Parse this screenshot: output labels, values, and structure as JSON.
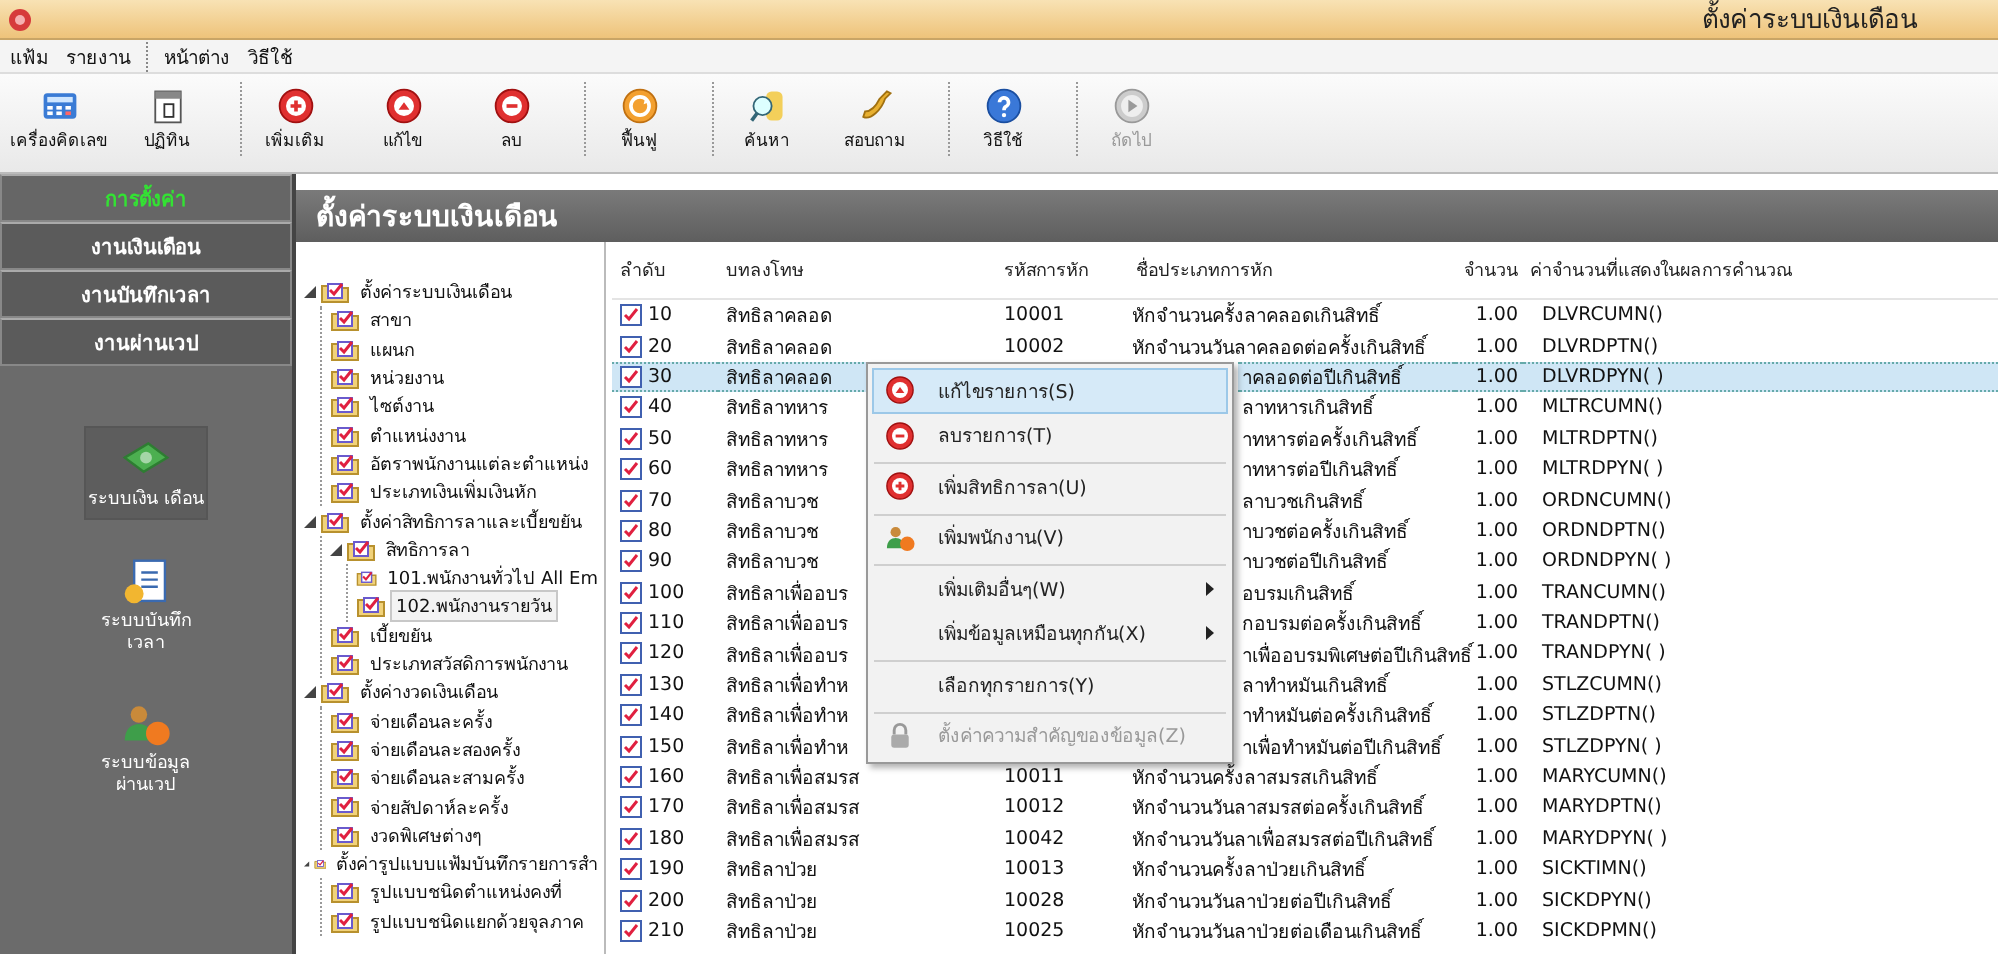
{
  "window": {
    "title": "ตั้งค่าระบบเงินเดือน"
  },
  "menu_bar": [
    {
      "label": "แฟ้ม",
      "separator_before": false
    },
    {
      "label": "รายงาน",
      "separator_before": false
    },
    {
      "label": "หน้าต่าง",
      "separator_before": true
    },
    {
      "label": "วิธีใช้",
      "separator_before": false
    }
  ],
  "toolbar": [
    {
      "label": "เครื่องคิดเลข",
      "kind": "calculator",
      "disabled": false,
      "separator_before": false
    },
    {
      "label": "ปฏิทิน",
      "kind": "calendar",
      "disabled": false,
      "separator_before": false
    },
    {
      "label": "เพิ่มเติม",
      "kind": "add",
      "disabled": false,
      "separator_before": true
    },
    {
      "label": "แก้ไข",
      "kind": "edit",
      "disabled": false,
      "separator_before": false
    },
    {
      "label": "ลบ",
      "kind": "delete",
      "disabled": false,
      "separator_before": false
    },
    {
      "label": "ฟื้นฟู",
      "kind": "refresh",
      "disabled": false,
      "separator_before": true
    },
    {
      "label": "ค้นหา",
      "kind": "search",
      "disabled": false,
      "separator_before": true
    },
    {
      "label": "สอบถาม",
      "kind": "phone",
      "disabled": false,
      "separator_before": false
    },
    {
      "label": "วิธีใช้",
      "kind": "help",
      "disabled": false,
      "separator_before": true
    },
    {
      "label": "ถัดไป",
      "kind": "next",
      "disabled": true,
      "separator_before": true
    }
  ],
  "sidebar": {
    "tabs": [
      {
        "label": "การตั้งค่า",
        "selected": true
      },
      {
        "label": "งานเงินเดือน",
        "selected": false
      },
      {
        "label": "งานบันทึกเวลา",
        "selected": false
      },
      {
        "label": "งานผ่านเวป",
        "selected": false
      }
    ],
    "systems": [
      {
        "label": "ระบบเงิน เดือน",
        "kind": "money",
        "selected": true
      },
      {
        "label": "ระบบบันทึก เวลา",
        "kind": "document",
        "selected": false
      },
      {
        "label": "ระบบข้อมูล ผ่านเวป",
        "kind": "people",
        "selected": false
      }
    ]
  },
  "panel_title": "ตั้งค่าระบบเงินเดือน",
  "tree": [
    {
      "label": "ตั้งค่าระบบเงินเดือน",
      "selected": false,
      "expanded": true,
      "children": [
        {
          "label": "สาขา",
          "selected": false
        },
        {
          "label": "แผนก",
          "selected": false
        },
        {
          "label": "หน่วยงาน",
          "selected": false
        },
        {
          "label": "ไซต์งาน",
          "selected": false
        },
        {
          "label": "ตำแหน่งงาน",
          "selected": false
        },
        {
          "label": "อัตราพนักงานแต่ละตำแหน่ง",
          "selected": false
        },
        {
          "label": "ประเภทเงินเพิ่มเงินหัก",
          "selected": false
        }
      ]
    },
    {
      "label": "ตั้งค่าสิทธิการลาและเบี้ยขยัน",
      "selected": false,
      "expanded": true,
      "children": [
        {
          "label": "สิทธิการลา",
          "selected": false,
          "expanded": true,
          "children": [
            {
              "label": "101.พนักงานทั่วไป All Em",
              "selected": false
            },
            {
              "label": "102.พนักงานรายวัน",
              "selected": true
            }
          ]
        },
        {
          "label": "เบี้ยขยัน",
          "selected": false
        },
        {
          "label": "ประเภทสวัสดิการพนักงาน",
          "selected": false
        }
      ]
    },
    {
      "label": "ตั้งค่างวดเงินเดือน",
      "selected": false,
      "expanded": true,
      "children": [
        {
          "label": "จ่ายเดือนละครั้ง",
          "selected": false
        },
        {
          "label": "จ่ายเดือนละสองครั้ง",
          "selected": false
        },
        {
          "label": "จ่ายเดือนละสามครั้ง",
          "selected": false
        },
        {
          "label": "จ่ายสัปดาห์ละครั้ง",
          "selected": false
        },
        {
          "label": "งวดพิเศษต่างๆ",
          "selected": false
        }
      ]
    },
    {
      "label": "ตั้งค่ารูปแบบแฟ้มบันทึกรายการสำ",
      "selected": false,
      "expanded": true,
      "children": [
        {
          "label": "รูปแบบชนิดตำแหน่งคงที่",
          "selected": false
        },
        {
          "label": "รูปแบบชนิดแยกด้วยจุลภาค",
          "selected": false
        }
      ]
    }
  ],
  "table": {
    "columns": [
      "ลำดับ",
      "บทลงโทษ",
      "รหัสการหัก",
      "ชื่อประเภทการหัก",
      "จำนวน",
      "ค่าจำนวนที่แสดงในผลการคำนวณ"
    ],
    "rows": [
      {
        "seq": "10",
        "penalty": "สิทธิลาคลอด",
        "code": "10001",
        "name": "หักจำนวนครั้งลาคลอดเกินสิทธิ์",
        "amount": "1.00",
        "formula": "DLVRCUMN()",
        "selected": false,
        "under_menu": false
      },
      {
        "seq": "20",
        "penalty": "สิทธิลาคลอด",
        "code": "10002",
        "name": "หักจำนวนวันลาคลอดต่อครั้งเกินสิทธิ์",
        "amount": "1.00",
        "formula": "DLVRDPTN()",
        "selected": false,
        "under_menu": false
      },
      {
        "seq": "30",
        "penalty": "สิทธิลาคลอด",
        "name": "าคลอดต่อปีเกินสิทธิ์",
        "amount": "1.00",
        "formula": "DLVRDPYN( )",
        "selected": true,
        "under_menu": true
      },
      {
        "seq": "40",
        "penalty": "สิทธิลาทหาร",
        "name": "ลาทหารเกินสิทธิ์",
        "amount": "1.00",
        "formula": "MLTRCUMN()",
        "selected": false,
        "under_menu": true
      },
      {
        "seq": "50",
        "penalty": "สิทธิลาทหาร",
        "name": "าทหารต่อครั้งเกินสิทธิ์",
        "amount": "1.00",
        "formula": "MLTRDPTN()",
        "selected": false,
        "under_menu": true
      },
      {
        "seq": "60",
        "penalty": "สิทธิลาทหาร",
        "name": "าทหารต่อปีเกินสิทธิ์",
        "amount": "1.00",
        "formula": "MLTRDPYN( )",
        "selected": false,
        "under_menu": true
      },
      {
        "seq": "70",
        "penalty": "สิทธิลาบวช",
        "name": "ลาบวชเกินสิทธิ์",
        "amount": "1.00",
        "formula": "ORDNCUMN()",
        "selected": false,
        "under_menu": true
      },
      {
        "seq": "80",
        "penalty": "สิทธิลาบวช",
        "name": "าบวชต่อครั้งเกินสิทธิ์",
        "amount": "1.00",
        "formula": "ORDNDPTN()",
        "selected": false,
        "under_menu": true
      },
      {
        "seq": "90",
        "penalty": "สิทธิลาบวช",
        "name": "าบวชต่อปีเกินสิทธิ์",
        "amount": "1.00",
        "formula": "ORDNDPYN( )",
        "selected": false,
        "under_menu": true
      },
      {
        "seq": "100",
        "penalty": "สิทธิลาเพื่ออบร",
        "name": "อบรมเกินสิทธิ์",
        "amount": "1.00",
        "formula": "TRANCUMN()",
        "selected": false,
        "under_menu": true
      },
      {
        "seq": "110",
        "penalty": "สิทธิลาเพื่ออบร",
        "name": "กอบรมต่อครั้งเกินสิทธิ์",
        "amount": "1.00",
        "formula": "TRANDPTN()",
        "selected": false,
        "under_menu": true
      },
      {
        "seq": "120",
        "penalty": "สิทธิลาเพื่ออบร",
        "name": "าเพื่ออบรมพิเศษต่อปีเกินสิทธิ์",
        "amount": "1.00",
        "formula": "TRANDPYN( )",
        "selected": false,
        "under_menu": true
      },
      {
        "seq": "130",
        "penalty": "สิทธิลาเพื่อทำห",
        "name": "ลาทำหมันเกินสิทธิ์",
        "amount": "1.00",
        "formula": "STLZCUMN()",
        "selected": false,
        "under_menu": true
      },
      {
        "seq": "140",
        "penalty": "สิทธิลาเพื่อทำห",
        "name": "าทำหมันต่อครั้งเกินสิทธิ์",
        "amount": "1.00",
        "formula": "STLZDPTN()",
        "selected": false,
        "under_menu": true
      },
      {
        "seq": "150",
        "penalty": "สิทธิลาเพื่อทำห",
        "name": "าเพื่อทำหมันต่อปีเกินสิทธิ์",
        "amount": "1.00",
        "formula": "STLZDPYN( )",
        "selected": false,
        "under_menu": true
      },
      {
        "seq": "160",
        "penalty": "สิทธิลาเพื่อสมรส",
        "code": "10011",
        "name": "หักจำนวนครั้งลาสมรสเกินสิทธิ์",
        "amount": "1.00",
        "formula": "MARYCUMN()",
        "selected": false,
        "under_menu": false
      },
      {
        "seq": "170",
        "penalty": "สิทธิลาเพื่อสมรส",
        "code": "10012",
        "name": "หักจำนวนวันลาสมรสต่อครั้งเกินสิทธิ์",
        "amount": "1.00",
        "formula": "MARYDPTN()",
        "selected": false,
        "under_menu": false
      },
      {
        "seq": "180",
        "penalty": "สิทธิลาเพื่อสมรส",
        "code": "10042",
        "name": "หักจำนวนวันลาเพื่อสมรสต่อปีเกินสิทธิ์",
        "amount": "1.00",
        "formula": "MARYDPYN( )",
        "selected": false,
        "under_menu": false
      },
      {
        "seq": "190",
        "penalty": "สิทธิลาป่วย",
        "code": "10013",
        "name": "หักจำนวนครั้งลาป่วยเกินสิทธิ์",
        "amount": "1.00",
        "formula": "SICKTIMN()",
        "selected": false,
        "under_menu": false
      },
      {
        "seq": "200",
        "penalty": "สิทธิลาป่วย",
        "code": "10028",
        "name": "หักจำนวนวันลาป่วยต่อปีเกินสิทธิ์",
        "amount": "1.00",
        "formula": "SICKDPYN()",
        "selected": false,
        "under_menu": false
      },
      {
        "seq": "210",
        "penalty": "สิทธิลาป่วย",
        "code": "10025",
        "name": "หักจำนวนวันลาป่วยต่อเดือนเกินสิทธิ์",
        "amount": "1.00",
        "formula": "SICKDPMN()",
        "selected": false,
        "under_menu": false
      }
    ]
  },
  "context_menu": [
    {
      "label": "แก้ไขรายการ(S)",
      "kind": "edit",
      "selected": true,
      "disabled": false,
      "submenu": false,
      "separator_before": false
    },
    {
      "label": "ลบรายการ(T)",
      "kind": "delete",
      "selected": false,
      "disabled": false,
      "submenu": false,
      "separator_before": false
    },
    {
      "label": "เพิ่มสิทธิการลา(U)",
      "kind": "add",
      "selected": false,
      "disabled": false,
      "submenu": false,
      "separator_before": true
    },
    {
      "label": "เพิ่มพนักงาน(V)",
      "kind": "people",
      "selected": false,
      "disabled": false,
      "submenu": false,
      "separator_before": true
    },
    {
      "label": "เพิ่มเติมอื่นๆ(W)",
      "kind": "plain",
      "selected": false,
      "disabled": false,
      "submenu": true,
      "separator_before": true
    },
    {
      "label": "เพิ่มข้อมูลเหมือนทุกกัน(X)",
      "kind": "plain",
      "selected": false,
      "disabled": false,
      "submenu": true,
      "separator_before": false
    },
    {
      "label": "เลือกทุกรายการ(Y)",
      "kind": "plain",
      "selected": false,
      "disabled": false,
      "submenu": false,
      "separator_before": true
    },
    {
      "label": "ตั้งค่าความสำคัญของข้อมูล(Z)",
      "kind": "lock",
      "selected": false,
      "disabled": true,
      "submenu": false,
      "separator_before": true
    }
  ]
}
